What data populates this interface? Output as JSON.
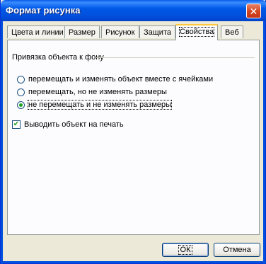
{
  "window": {
    "title": "Формат рисунка",
    "close_glyph": "✕"
  },
  "tabs": [
    {
      "label": "Цвета и линии",
      "selected": false
    },
    {
      "label": "Размер",
      "selected": false
    },
    {
      "label": "Рисунок",
      "selected": false
    },
    {
      "label": "Защита",
      "selected": false
    },
    {
      "label": "Свойства",
      "selected": true
    },
    {
      "label": "Веб",
      "selected": false
    }
  ],
  "properties": {
    "group_label": "Привязка объекта к фону",
    "options": [
      {
        "label": "перемещать и изменять объект вместе с ячейками",
        "checked": false
      },
      {
        "label": "перемещать, но не изменять размеры",
        "checked": false
      },
      {
        "label": "не перемещать и не изменять размеры",
        "checked": true
      }
    ],
    "print_checkbox": {
      "label": "Выводить объект на печать",
      "checked": true
    }
  },
  "buttons": {
    "ok": "ОК",
    "cancel": "Отмена"
  },
  "colors": {
    "titlebar": "#0058e6",
    "selected_tab_accent": "#ffc83c",
    "radio_dot": "#21a121",
    "face": "#ece9d8"
  },
  "icons": {
    "close": "close-icon",
    "check": "checkmark-icon"
  }
}
